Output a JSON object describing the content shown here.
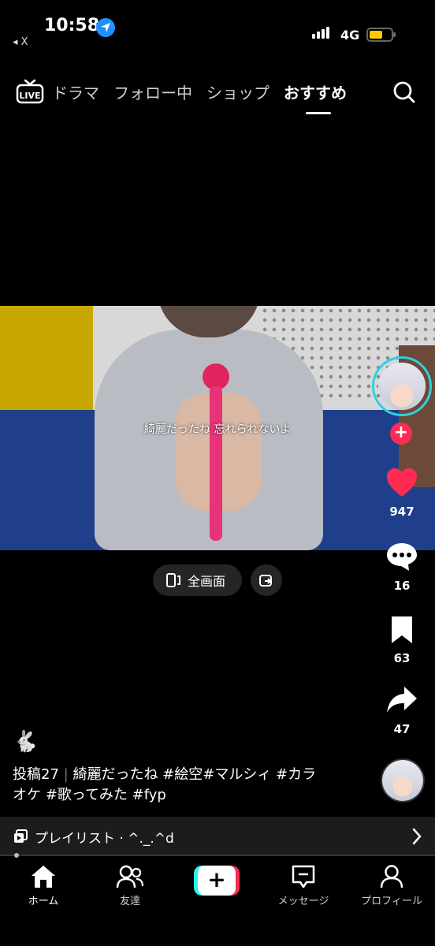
{
  "status": {
    "time": "10:58",
    "back_app": "◂ X",
    "network": "4G",
    "battery_level": 0.6
  },
  "topnav": {
    "live_label": "LIVE",
    "tabs": [
      {
        "label": "ドラマ",
        "active": false
      },
      {
        "label": "フォロー中",
        "active": false
      },
      {
        "label": "ショップ",
        "active": false
      },
      {
        "label": "おすすめ",
        "active": true
      }
    ],
    "search_icon": "search-icon"
  },
  "video": {
    "subtitle": "綺麗だったね 忘れられないよ"
  },
  "video_actions": {
    "fullscreen_label": "全画面"
  },
  "rail": {
    "likes": "947",
    "comments": "16",
    "bookmarks": "63",
    "shares": "47",
    "like_color": "#fe2c55",
    "follow_label": "+"
  },
  "caption": {
    "emoji": "🐇",
    "post_no": "投稿27",
    "separator": "|",
    "text": "綺麗だったね #絵空#マルシィ #カラオケ #歌ってみた #fyp"
  },
  "playlist": {
    "label": "プレイリスト · ^._.^d"
  },
  "bottomnav": {
    "home": "ホーム",
    "friends": "友達",
    "create": "+",
    "messages": "メッセージ",
    "profile": "プロフィール"
  }
}
